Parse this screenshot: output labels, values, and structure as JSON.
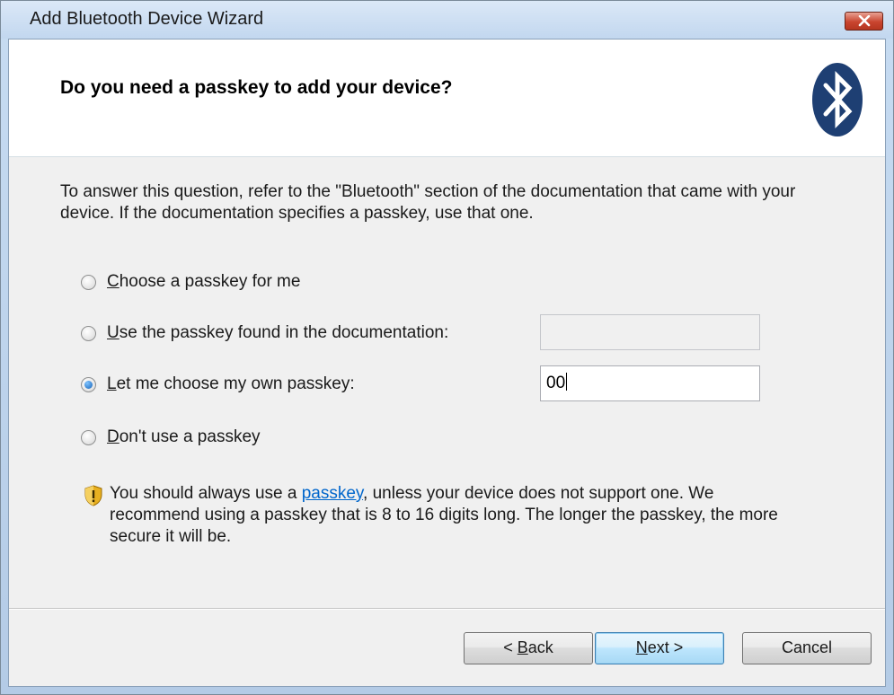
{
  "window": {
    "title": "Add Bluetooth Device Wizard",
    "close_glyph": "x"
  },
  "header": {
    "title": "Do you need a passkey to add your device?",
    "logo_icon": "bluetooth-icon"
  },
  "intro": {
    "text": "To answer this question, refer to the \"Bluetooth\" section of the documentation that came with your device. If the documentation specifies a passkey, use that one."
  },
  "options": [
    {
      "mnemonic": "C",
      "rest": "hoose a passkey for me",
      "selected": false
    },
    {
      "mnemonic": "U",
      "rest": "se the passkey found in the documentation:",
      "selected": false
    },
    {
      "mnemonic": "L",
      "rest": "et me choose my own passkey:",
      "selected": true
    },
    {
      "mnemonic": "D",
      "rest": "on't use a passkey",
      "selected": false
    }
  ],
  "fields": {
    "documentation_passkey": "",
    "own_passkey": "00"
  },
  "info": {
    "before": "You should always use a ",
    "link": "passkey",
    "after": ", unless your device does not support one. We recommend using a passkey that is 8 to 16 digits long. The longer the passkey, the more secure it will be.",
    "icon": "shield-warning-icon"
  },
  "buttons": {
    "back": {
      "prefix": "< ",
      "mnemonic": "B",
      "rest": "ack"
    },
    "next": {
      "mnemonic": "N",
      "rest": "ext >"
    },
    "cancel": "Cancel"
  },
  "colors": {
    "link": "#0066cc",
    "bluetooth_badge": "#1e3f73",
    "close_button": "#c9452f"
  }
}
